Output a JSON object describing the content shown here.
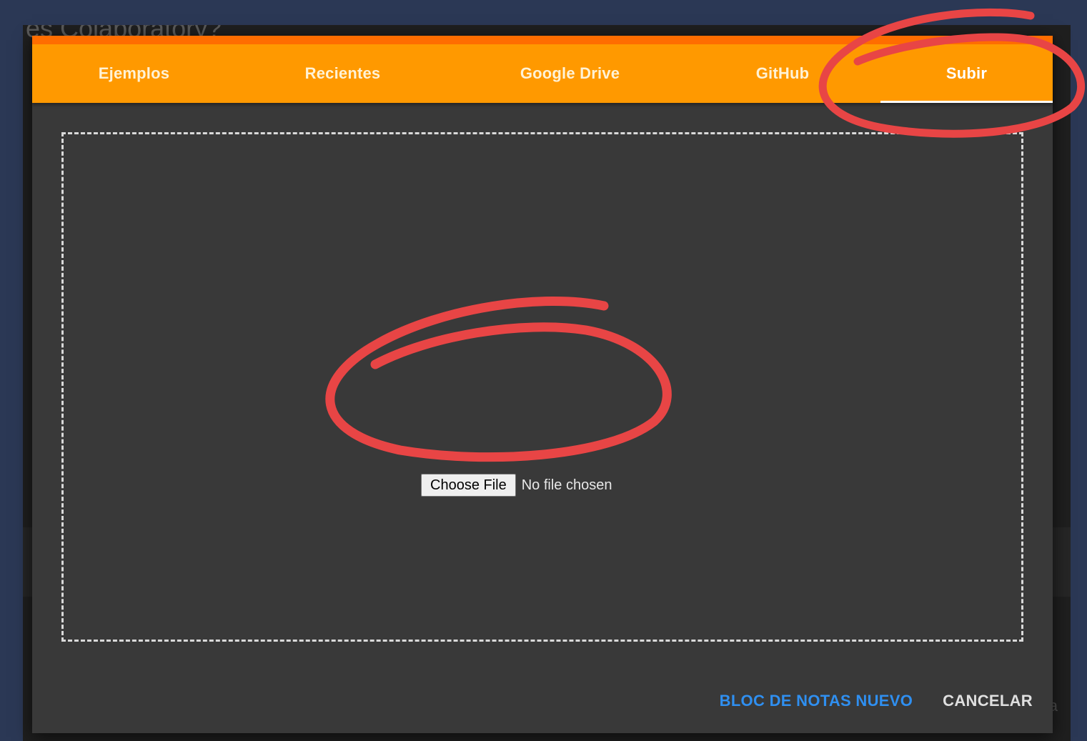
{
  "background_page": {
    "title_fragment": "es Colaboratory?",
    "right_fragment": "lita"
  },
  "dialog": {
    "tabs": [
      {
        "label": "Ejemplos",
        "active": false
      },
      {
        "label": "Recientes",
        "active": false
      },
      {
        "label": "Google Drive",
        "active": false
      },
      {
        "label": "GitHub",
        "active": false
      },
      {
        "label": "Subir",
        "active": true
      }
    ],
    "upload": {
      "button_label": "Choose File",
      "status_text": "No file chosen"
    },
    "actions": {
      "new_notebook_label": "BLOC DE NOTAS NUEVO",
      "cancel_label": "CANCELAR"
    }
  },
  "colors": {
    "tab_bar": "#ff9900",
    "tab_bar_top": "#ff6d00",
    "dialog_bg": "#393939",
    "primary_action": "#2f8ff0",
    "annotation": "#e84545",
    "page_border": "#2b3855"
  },
  "annotations": [
    {
      "type": "hand-drawn-circle",
      "target": "tab-subir"
    },
    {
      "type": "hand-drawn-circle",
      "target": "file-chooser"
    }
  ]
}
